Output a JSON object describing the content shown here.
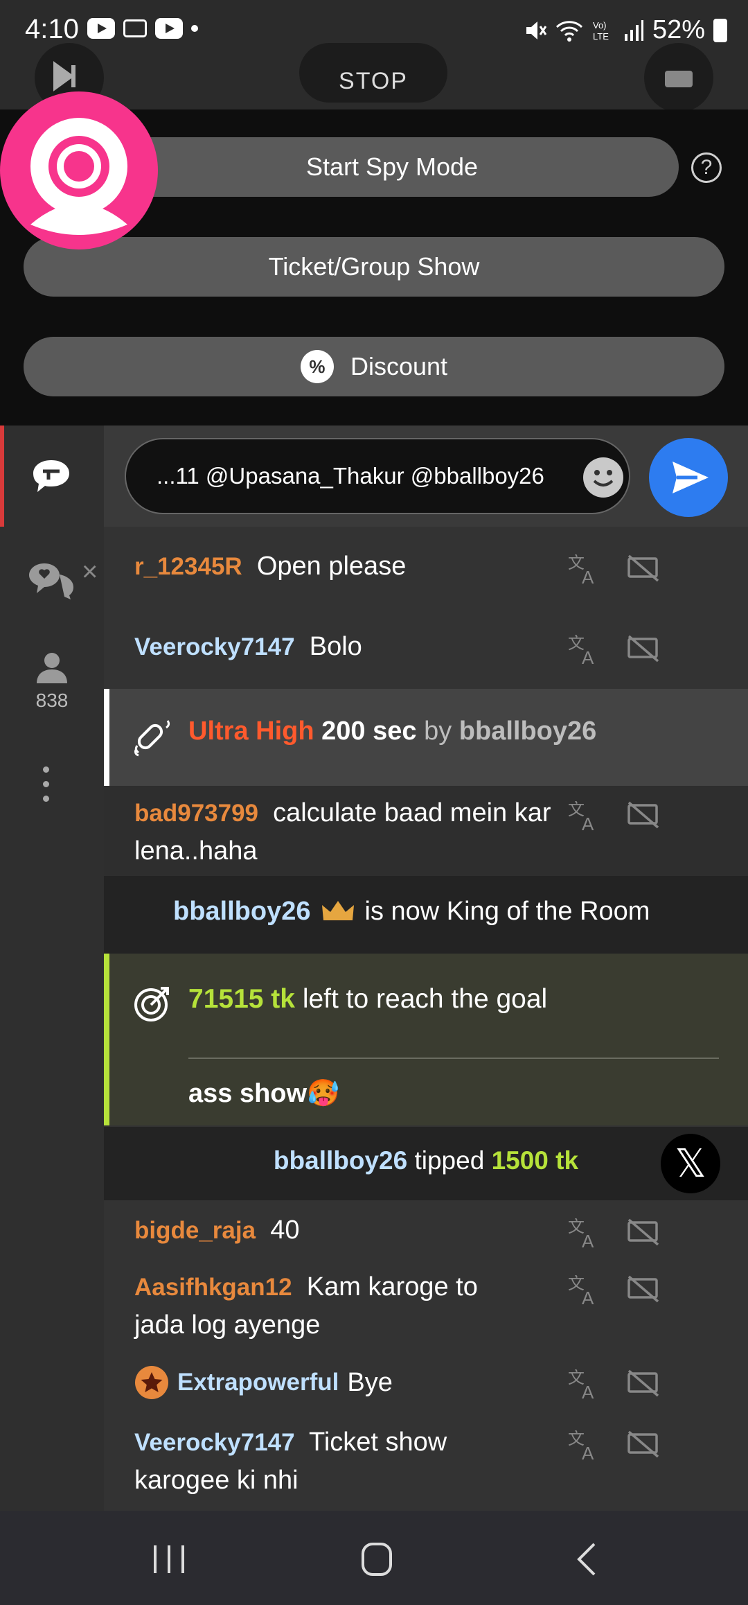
{
  "status_bar": {
    "time": "4:10",
    "battery": "52%"
  },
  "panel": {
    "spy_label": "Start Spy Mode",
    "help_symbol": "?",
    "ticket_label": "Ticket/Group Show",
    "discount_label": "Discount",
    "discount_symbol": "%",
    "stop_label": "STOP"
  },
  "sidebar": {
    "viewer_count": "838"
  },
  "input": {
    "value": "‎...11 @Upasana_Thakur @bballboy26"
  },
  "messages": [
    {
      "user": "r_12345R",
      "text": "Open please"
    },
    {
      "user": "Veerocky7147",
      "text": "Bolo"
    },
    {
      "user": "bad973799",
      "text": "calculate baad mein kar lena..haha"
    },
    {
      "user": "bigde_raja",
      "text": "40"
    },
    {
      "user": "Aasifhkgan12",
      "text": "Kam karoge to jada log ayenge"
    },
    {
      "user": "Extrapowerful",
      "text": "Bye"
    },
    {
      "user": "Veerocky7147",
      "text": "Ticket show karogee ki nhi"
    }
  ],
  "tip_event": {
    "level": "Ultra High",
    "duration": "200 sec",
    "by": "by",
    "user": "bballboy26"
  },
  "king_event": {
    "user": "bballboy26",
    "text": "is now King of the Room"
  },
  "goal": {
    "amount": "71515 tk",
    "text": "left to reach the goal",
    "title": "ass show🥵"
  },
  "tipped": {
    "user": "bballboy26",
    "verb": "tipped",
    "amount": "1500 tk"
  },
  "colors": {
    "accent_pink": "#f7348c",
    "send_blue": "#2d7cf0",
    "goal_green": "#b6e23a",
    "username_orange": "#e8893d",
    "username_blue": "#bfe0ff",
    "ultra_red": "#ff5a2d"
  }
}
